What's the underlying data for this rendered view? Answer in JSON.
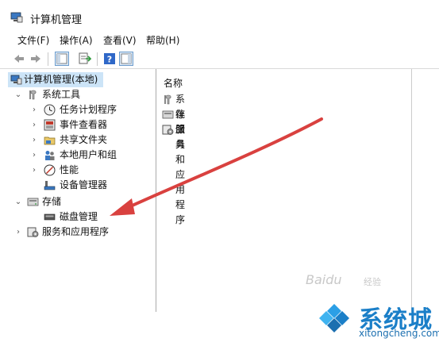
{
  "window": {
    "title": "计算机管理"
  },
  "menu": {
    "file": "文件(F)",
    "action": "操作(A)",
    "view": "查看(V)",
    "help": "帮助(H)"
  },
  "tree": {
    "root": "计算机管理(本地)",
    "system_tools": "系统工具",
    "task_scheduler": "任务计划程序",
    "event_viewer": "事件查看器",
    "shared_folders": "共享文件夹",
    "local_users": "本地用户和组",
    "performance": "性能",
    "device_manager": "设备管理器",
    "storage": "存储",
    "disk_management": "磁盘管理",
    "services_apps": "服务和应用程序"
  },
  "list": {
    "header": "名称",
    "items": [
      "系统工具",
      "存储",
      "服务和应用程序"
    ]
  },
  "watermark": {
    "baidu": "Baidu",
    "jingyan": "经验"
  },
  "logo": {
    "text": "系统城",
    "url": "xitongcheng.com"
  },
  "colors": {
    "selected": "#cce4f7",
    "arrow": "#d9413f",
    "logo_blue": "#1b7fc8"
  }
}
